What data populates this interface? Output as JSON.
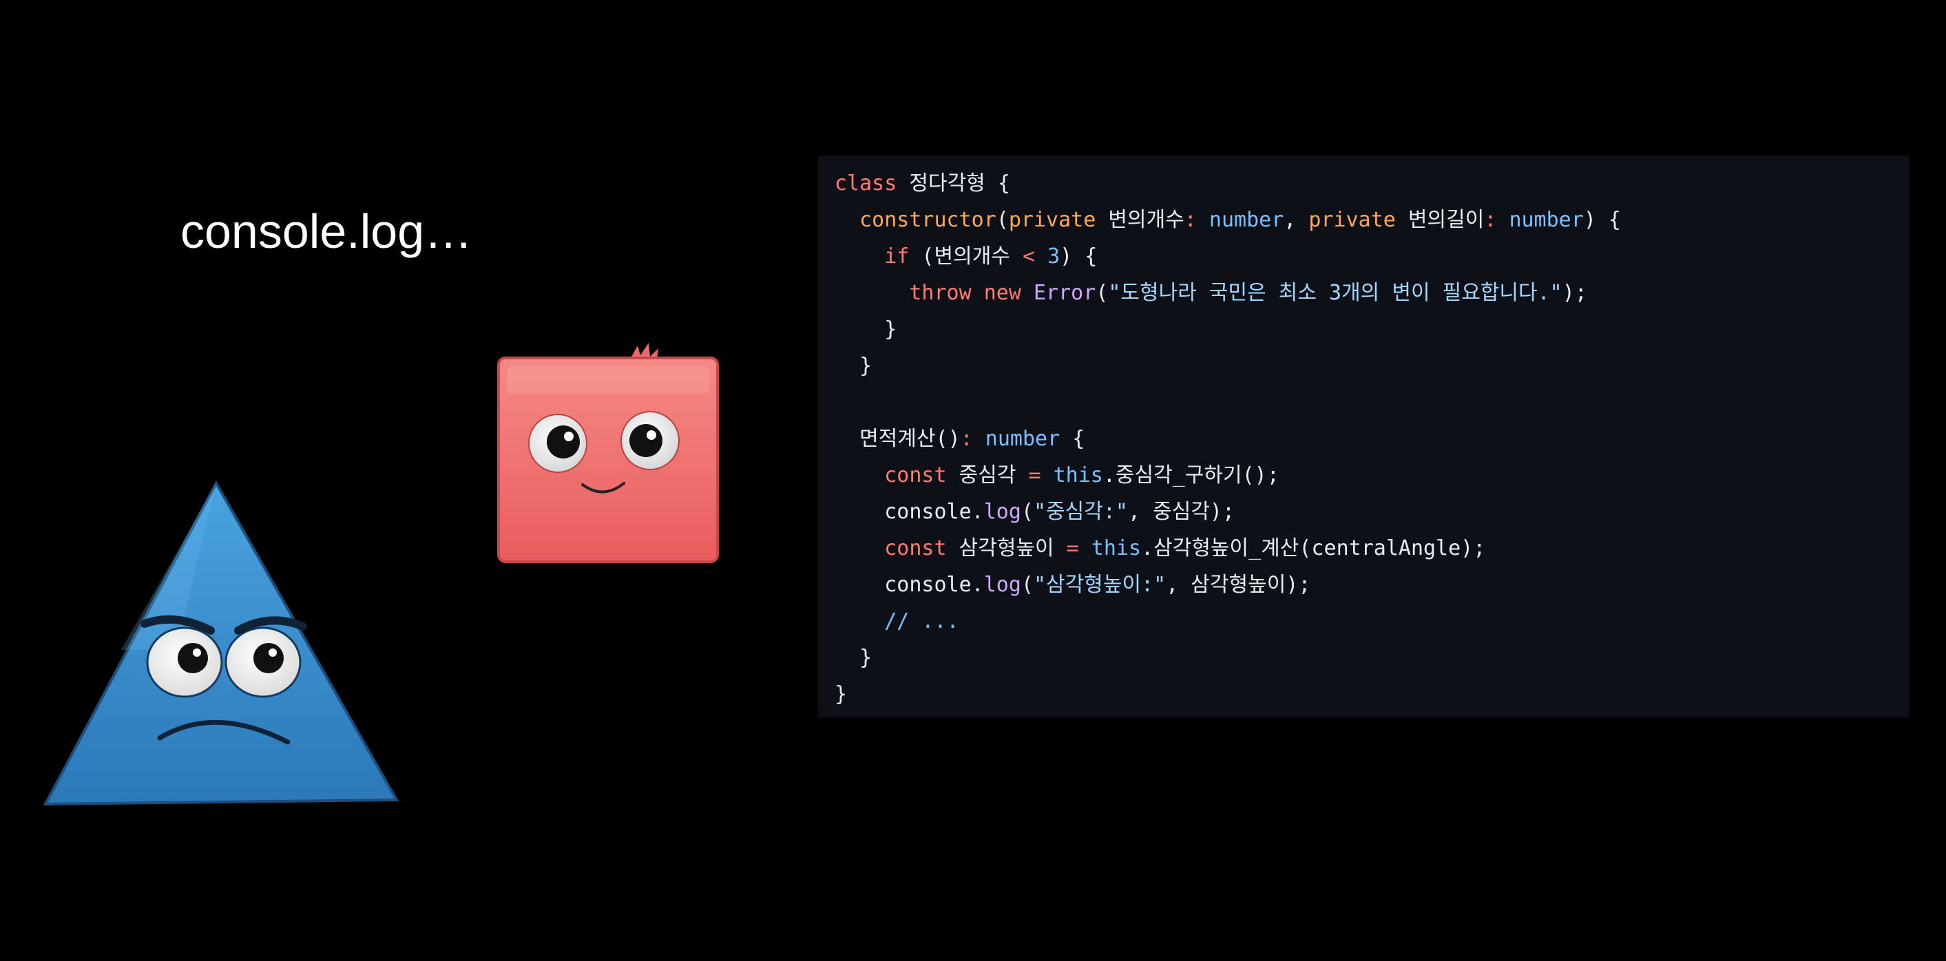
{
  "caption": "console.log…",
  "colors": {
    "background": "#000000",
    "code_background": "#0d1117",
    "square_character": "#f07070",
    "triangle_character": "#3a8fd0"
  },
  "characters": {
    "square": {
      "icon": "smiling-red-square-character-icon"
    },
    "triangle": {
      "icon": "grumpy-blue-triangle-character-icon"
    }
  },
  "code": {
    "lines": [
      [
        {
          "t": "class ",
          "c": "kw"
        },
        {
          "t": "정다각형 {",
          "c": "id"
        }
      ],
      [
        {
          "t": "  ",
          "c": "id"
        },
        {
          "t": "constructor",
          "c": "def"
        },
        {
          "t": "(",
          "c": "id"
        },
        {
          "t": "private ",
          "c": "def"
        },
        {
          "t": "변의개수",
          "c": "id"
        },
        {
          "t": ": ",
          "c": "op"
        },
        {
          "t": "number",
          "c": "type"
        },
        {
          "t": ", ",
          "c": "id"
        },
        {
          "t": "private ",
          "c": "def"
        },
        {
          "t": "변의길이",
          "c": "id"
        },
        {
          "t": ": ",
          "c": "op"
        },
        {
          "t": "number",
          "c": "type"
        },
        {
          "t": ") {",
          "c": "id"
        }
      ],
      [
        {
          "t": "    ",
          "c": "id"
        },
        {
          "t": "if",
          "c": "kw"
        },
        {
          "t": " (변의개수 ",
          "c": "id"
        },
        {
          "t": "<",
          "c": "op"
        },
        {
          "t": " ",
          "c": "id"
        },
        {
          "t": "3",
          "c": "num"
        },
        {
          "t": ") {",
          "c": "id"
        }
      ],
      [
        {
          "t": "      ",
          "c": "id"
        },
        {
          "t": "throw new ",
          "c": "kw"
        },
        {
          "t": "Error",
          "c": "fn"
        },
        {
          "t": "(",
          "c": "id"
        },
        {
          "t": "\"도형나라 국민은 최소 3개의 변이 필요합니다.\"",
          "c": "str"
        },
        {
          "t": ");",
          "c": "id"
        }
      ],
      [
        {
          "t": "    }",
          "c": "id"
        }
      ],
      [
        {
          "t": "  }",
          "c": "id"
        }
      ],
      [
        {
          "t": "",
          "c": "id"
        }
      ],
      [
        {
          "t": "  ",
          "c": "id"
        },
        {
          "t": "면적계산",
          "c": "id"
        },
        {
          "t": "()",
          "c": "id"
        },
        {
          "t": ": ",
          "c": "op"
        },
        {
          "t": "number",
          "c": "type"
        },
        {
          "t": " {",
          "c": "id"
        }
      ],
      [
        {
          "t": "    ",
          "c": "id"
        },
        {
          "t": "const ",
          "c": "kw"
        },
        {
          "t": "중심각 ",
          "c": "id"
        },
        {
          "t": "=",
          "c": "op"
        },
        {
          "t": " ",
          "c": "id"
        },
        {
          "t": "this",
          "c": "type"
        },
        {
          "t": ".중심각_구하기();",
          "c": "id"
        }
      ],
      [
        {
          "t": "    ",
          "c": "id"
        },
        {
          "t": "console.",
          "c": "id"
        },
        {
          "t": "log",
          "c": "fn"
        },
        {
          "t": "(",
          "c": "id"
        },
        {
          "t": "\"중심각:\"",
          "c": "str"
        },
        {
          "t": ", 중심각);",
          "c": "id"
        }
      ],
      [
        {
          "t": "    ",
          "c": "id"
        },
        {
          "t": "const ",
          "c": "kw"
        },
        {
          "t": "삼각형높이 ",
          "c": "id"
        },
        {
          "t": "=",
          "c": "op"
        },
        {
          "t": " ",
          "c": "id"
        },
        {
          "t": "this",
          "c": "type"
        },
        {
          "t": ".삼각형높이_계산(centralAngle);",
          "c": "id"
        }
      ],
      [
        {
          "t": "    ",
          "c": "id"
        },
        {
          "t": "console.",
          "c": "id"
        },
        {
          "t": "log",
          "c": "fn"
        },
        {
          "t": "(",
          "c": "id"
        },
        {
          "t": "\"삼각형높이:\"",
          "c": "str"
        },
        {
          "t": ", 삼각형높이);",
          "c": "id"
        }
      ],
      [
        {
          "t": "    ",
          "c": "id"
        },
        {
          "t": "// ...",
          "c": "type"
        }
      ],
      [
        {
          "t": "  }",
          "c": "id"
        }
      ],
      [
        {
          "t": "}",
          "c": "id"
        }
      ]
    ]
  }
}
